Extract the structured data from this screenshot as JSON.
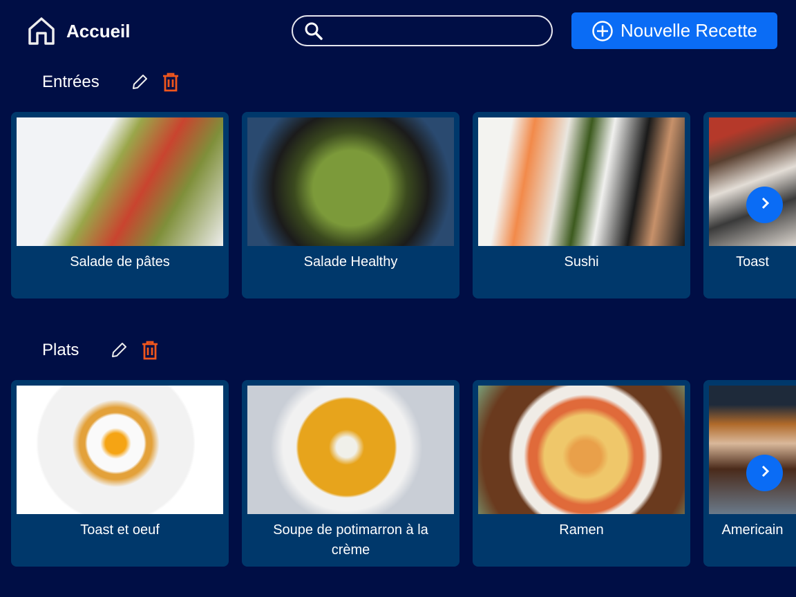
{
  "header": {
    "home_label": "Accueil",
    "search_placeholder": "",
    "search_value": "",
    "new_recipe_label": "Nouvelle Recette"
  },
  "colors": {
    "background": "#000e45",
    "card": "#00386b",
    "accent": "#0a6cf5",
    "delete": "#f0561d"
  },
  "sections": [
    {
      "title": "Entrées",
      "recipes": [
        {
          "name": "Salade de pâtes",
          "img": "linear-gradient(120deg,#f2f3f6 0 35%,#9aa64a 45%,#c9442f 60%,#7f8f3a 75%,#eeeeee)"
        },
        {
          "name": "Salade Healthy",
          "img": "radial-gradient(circle at 50% 55%,#7c9a3a 0 30%,#3b4a1e 45%,#1b1b1b 62%,#2a4a70 80%)"
        },
        {
          "name": "Sushi",
          "img": "linear-gradient(100deg,#f3f3f0 0 15%,#f28a4a 25%,#e9e6df 40%,#3c5a1e 50%,#f0f0ee 60%,#1a1a1a 75%,#c7916a 85%,#1a1a1a)"
        },
        {
          "name": "Toast",
          "img": "linear-gradient(160deg,#b5392a 0 15%,#5a4030 30%,#e3ddd6 50%,#3a3a3a 70%,#dcd6cf)"
        }
      ]
    },
    {
      "title": "Plats",
      "recipes": [
        {
          "name": "Toast et oeuf",
          "img": "radial-gradient(circle at 48% 45%,#f5a414 0 8%,#fafafa 12% 22%,#e3a13a 24% 28%,#f2f2f2 34% 60%,#ffffff 62%)"
        },
        {
          "name": "Soupe de potimarron à la crème",
          "img": "radial-gradient(circle at 48% 48%,#f0f0ea 0 8%,#e7a41c 14% 38%,#f1f1f1 40% 50%,#c9ced6 60%)"
        },
        {
          "name": "Ramen",
          "img": "radial-gradient(circle at 52% 55%,#e9a04a 0 12%,#efc76a 18% 32%,#e06a3a 38% 44%,#f0ece6 48% 56%,#6a3a1e 60% 80%,#7aa07a)"
        },
        {
          "name": "Americain",
          "img": "linear-gradient(180deg,#1e2a3a 0 15%,#b06a2a 30%,#d9b89a 45%,#4a2a1a 65%,#6a7a8a)"
        }
      ]
    }
  ]
}
